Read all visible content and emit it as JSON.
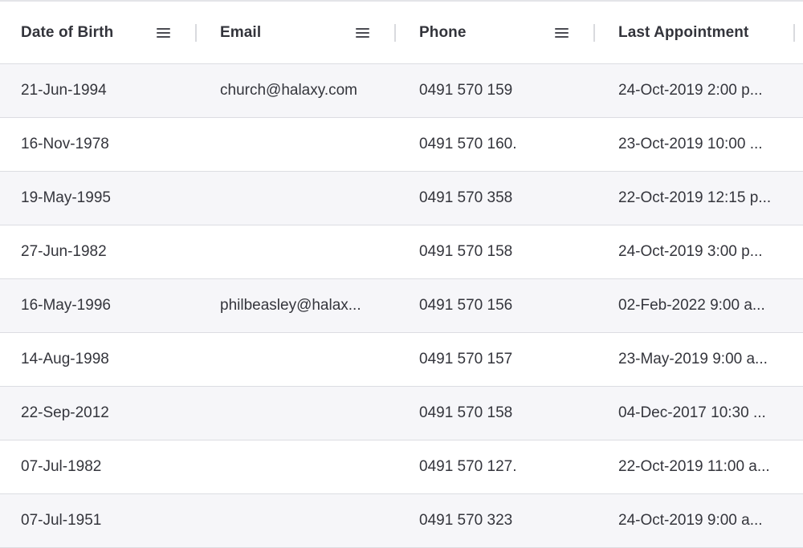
{
  "columns": [
    {
      "label": "Date of Birth",
      "has_menu": true
    },
    {
      "label": "Email",
      "has_menu": true
    },
    {
      "label": "Phone",
      "has_menu": true
    },
    {
      "label": "Last Appointment",
      "has_menu": false
    }
  ],
  "rows": [
    {
      "dob": "21-Jun-1994",
      "email": "church@halaxy.com",
      "phone": "0491 570 159",
      "last_appointment": "24-Oct-2019 2:00 p..."
    },
    {
      "dob": "16-Nov-1978",
      "email": "",
      "phone": "0491 570 160.",
      "last_appointment": "23-Oct-2019 10:00 ..."
    },
    {
      "dob": "19-May-1995",
      "email": "",
      "phone": "0491 570 358",
      "last_appointment": "22-Oct-2019 12:15 p..."
    },
    {
      "dob": "27-Jun-1982",
      "email": "",
      "phone": "0491 570 158",
      "last_appointment": "24-Oct-2019 3:00 p..."
    },
    {
      "dob": "16-May-1996",
      "email": "philbeasley@halax...",
      "phone": "0491 570 156",
      "last_appointment": "02-Feb-2022 9:00 a..."
    },
    {
      "dob": "14-Aug-1998",
      "email": "",
      "phone": "0491 570 157",
      "last_appointment": "23-May-2019 9:00 a..."
    },
    {
      "dob": "22-Sep-2012",
      "email": "",
      "phone": "0491 570 158",
      "last_appointment": "04-Dec-2017 10:30 ..."
    },
    {
      "dob": "07-Jul-1982",
      "email": "",
      "phone": "0491 570 127.",
      "last_appointment": "22-Oct-2019 11:00 a..."
    },
    {
      "dob": "07-Jul-1951",
      "email": "",
      "phone": "0491 570 323",
      "last_appointment": "24-Oct-2019 9:00 a..."
    }
  ],
  "icons": {
    "column_menu": "hamburger-menu-icon"
  },
  "colors": {
    "header_bg": "#ffffff",
    "row_alt_bg": "#f6f6f9",
    "row_bg": "#ffffff",
    "border": "#dcdde2",
    "text": "#34353c"
  }
}
